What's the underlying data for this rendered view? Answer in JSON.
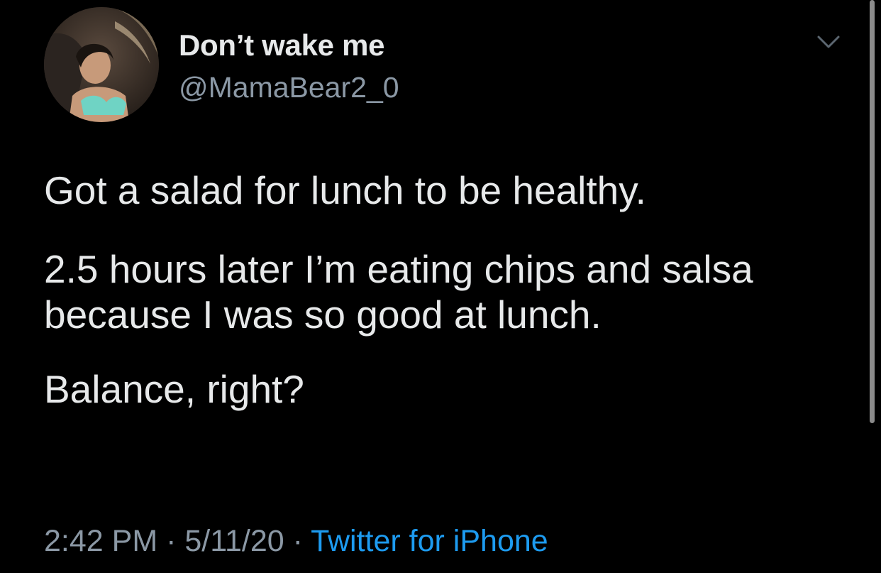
{
  "user": {
    "display_name": "Don’t wake me",
    "handle": "@MamaBear2_0",
    "avatar_icon": "profile-photo-avatar"
  },
  "tweet": {
    "paragraphs": [
      "Got a salad for lunch to be healthy.",
      "2.5 hours later I’m eating chips and salsa because I was so good at lunch.",
      "Balance, right?"
    ],
    "time": "2:42 PM",
    "separator": "·",
    "date": "5/11/20",
    "source": "Twitter for iPhone"
  },
  "icons": {
    "more_menu": "chevron-down-icon"
  },
  "colors": {
    "background": "#000000",
    "primary_text": "#e7e9ea",
    "secondary_text": "#8b98a5",
    "link": "#1d9bf0"
  }
}
